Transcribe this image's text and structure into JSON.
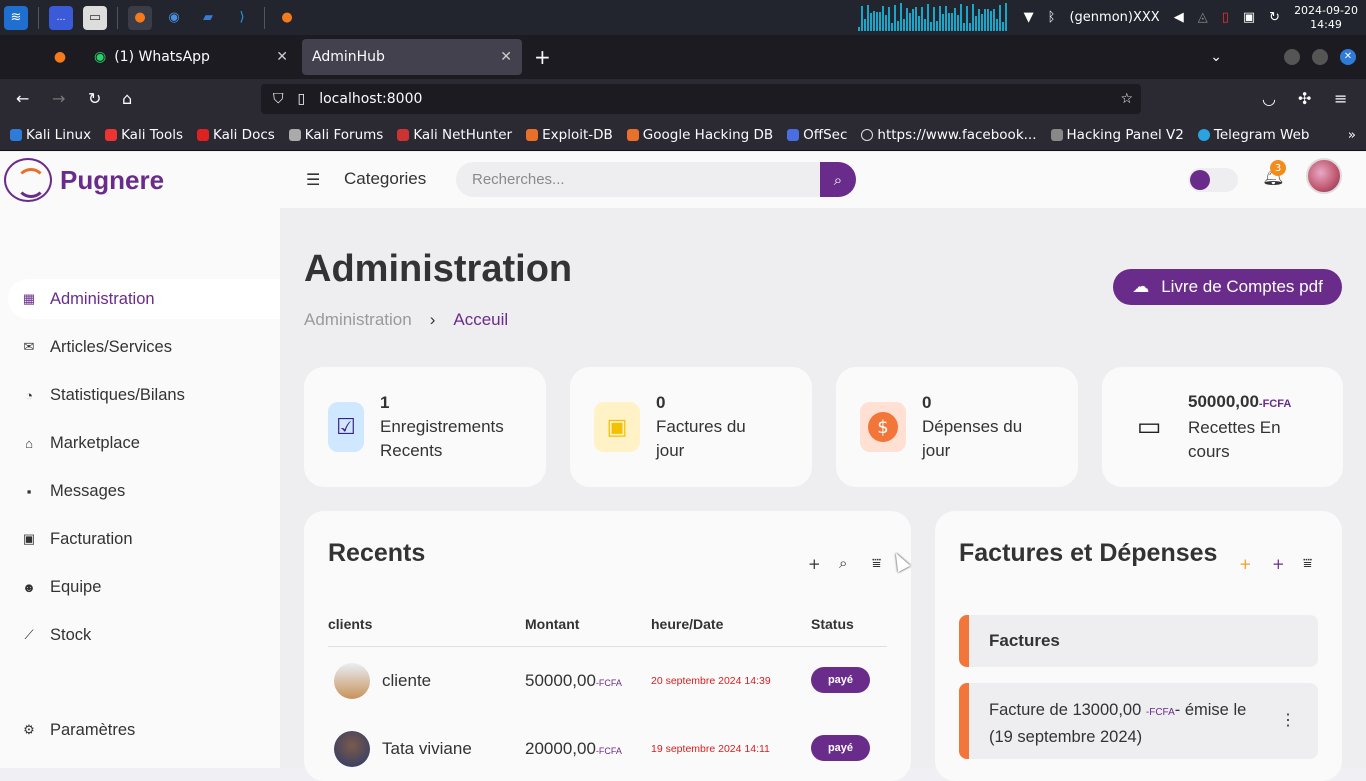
{
  "os": {
    "datetime_line1": "2024-09-20",
    "datetime_line2": "14:49",
    "network_label": "(genmon)XXX"
  },
  "browser": {
    "tabs": [
      {
        "label": "(1) WhatsApp"
      },
      {
        "label": "AdminHub"
      }
    ],
    "url": "localhost:8000",
    "bookmarks": [
      {
        "label": "Kali Linux"
      },
      {
        "label": "Kali Tools"
      },
      {
        "label": "Kali Docs"
      },
      {
        "label": "Kali Forums"
      },
      {
        "label": "Kali NetHunter"
      },
      {
        "label": "Exploit-DB"
      },
      {
        "label": "Google Hacking DB"
      },
      {
        "label": "OffSec"
      },
      {
        "label": "https://www.facebook..."
      },
      {
        "label": "Hacking Panel V2"
      },
      {
        "label": "Telegram Web"
      }
    ]
  },
  "app": {
    "brand": "Pugnere",
    "menu": [
      {
        "label": "Administration",
        "icon": "dashboard-icon"
      },
      {
        "label": "Articles/Services",
        "icon": "mail-icon"
      },
      {
        "label": "Statistiques/Bilans",
        "icon": "chart-pie-icon"
      },
      {
        "label": "Marketplace",
        "icon": "store-icon"
      },
      {
        "label": "Messages",
        "icon": "message-icon"
      },
      {
        "label": "Facturation",
        "icon": "money-icon"
      },
      {
        "label": "Equipe",
        "icon": "group-icon"
      },
      {
        "label": "Stock",
        "icon": "line-chart-icon"
      }
    ],
    "settings_label": "Paramètres",
    "topbar": {
      "categories": "Categories",
      "search_placeholder": "Recherches...",
      "notification_count": "3"
    },
    "page_title": "Administration",
    "breadcrumb": {
      "first": "Administration",
      "sep": "›",
      "current": "Acceuil"
    },
    "pdf_button": "Livre de Comptes pdf",
    "stats": [
      {
        "value": "1",
        "label_line1": "Enregistrements",
        "label_line2": "Recents",
        "icon": "calendar-check-icon",
        "color": "#3d1f8a"
      },
      {
        "value": "0",
        "label_line1": "Factures du",
        "label_line2": "jour",
        "icon": "money-bill-icon",
        "color": "#f5c000"
      },
      {
        "value": "0",
        "label_line1": "Dépenses du",
        "label_line2": "jour",
        "icon": "dollar-circle-icon",
        "color": "#f2753a"
      },
      {
        "value": "50000,00",
        "unit": "-FCFA",
        "label_line1": "Recettes En",
        "label_line2": "cours",
        "icon": "wallet-icon",
        "color": "#333333"
      }
    ],
    "recents": {
      "title": "Recents",
      "columns": [
        "clients",
        "Montant",
        "heure/Date",
        "Status"
      ],
      "rows": [
        {
          "client": "cliente",
          "amount": "50000,00",
          "unit": "-FCFA",
          "date": "20 septembre 2024 14:39",
          "status": "payé"
        },
        {
          "client": "Tata viviane",
          "amount": "20000,00",
          "unit": "-FCFA",
          "date": "19 septembre 2024 14:11",
          "status": "payé"
        }
      ]
    },
    "factures": {
      "title": "Factures et Dépenses",
      "section_label": "Factures",
      "item_prefix": "Facture de 13000,00",
      "item_unit": "-FCFA",
      "item_suffix": "- émise le",
      "item_line2": "(19 septembre 2024)"
    }
  }
}
